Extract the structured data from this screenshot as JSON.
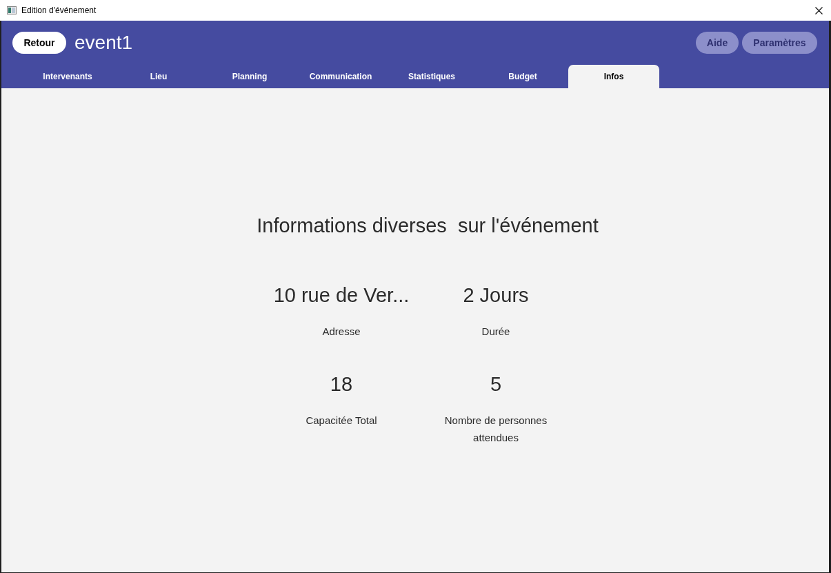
{
  "window": {
    "title": "Edition d'événement"
  },
  "header": {
    "back_button": "Retour",
    "event_name": "event1",
    "buttons": [
      "Aide",
      "Paramètres"
    ]
  },
  "tabs": [
    {
      "label": "Intervenants",
      "selected": false
    },
    {
      "label": "Lieu",
      "selected": false
    },
    {
      "label": "Planning",
      "selected": false
    },
    {
      "label": "Communication",
      "selected": false
    },
    {
      "label": "Statistiques",
      "selected": false
    },
    {
      "label": "Budget",
      "selected": false
    },
    {
      "label": "Infos",
      "selected": true
    }
  ],
  "info": {
    "title": "Informations diverses  sur l'événement",
    "items": [
      {
        "value": "10 rue de Ver...",
        "label": "Adresse"
      },
      {
        "value": "2 Jours",
        "label": "Durée"
      },
      {
        "value": "18",
        "label": "Capacitée Total"
      },
      {
        "value": "5",
        "label": "Nombre de personnes attendues"
      }
    ]
  }
}
